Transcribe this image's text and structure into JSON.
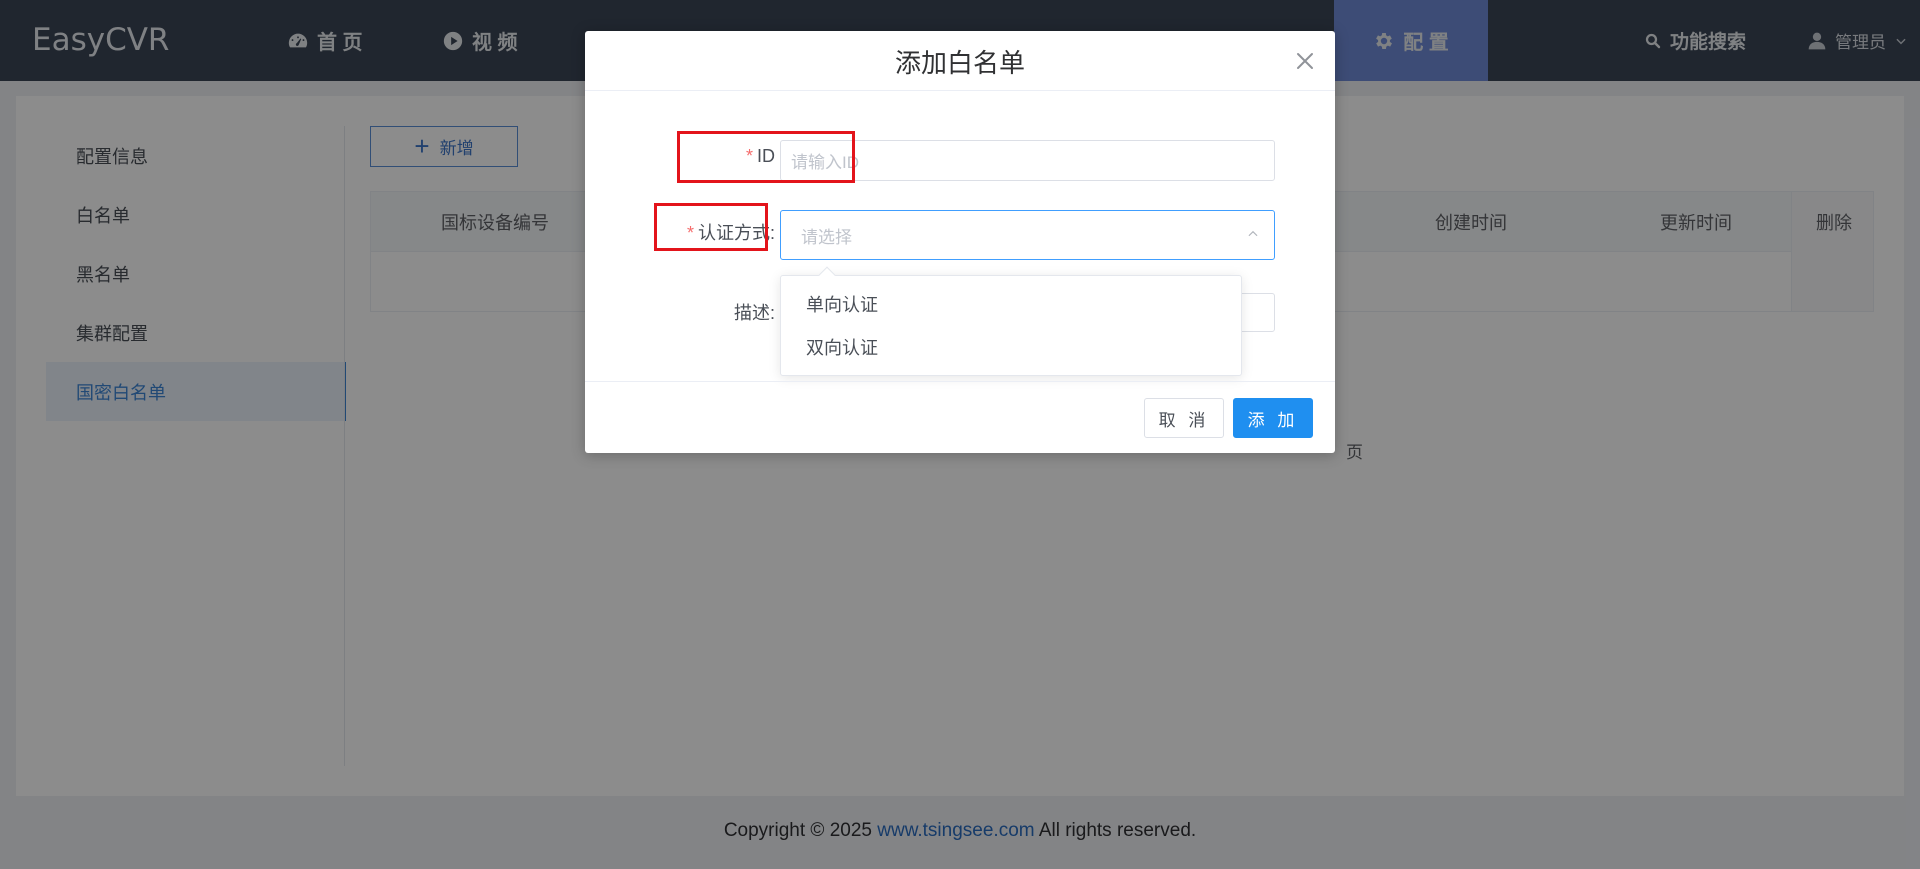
{
  "app": {
    "title": "EasyCVR"
  },
  "nav": {
    "home": "首 页",
    "video": "视 频",
    "config": "配 置",
    "search": "功能搜索",
    "user": "管理员"
  },
  "sidebar": {
    "items": [
      {
        "label": "配置信息"
      },
      {
        "label": "白名单"
      },
      {
        "label": "黑名单"
      },
      {
        "label": "集群配置"
      },
      {
        "label": "国密白名单"
      }
    ]
  },
  "toolbar": {
    "add_label": "新增"
  },
  "table": {
    "columns": [
      "国标设备编号",
      "创建时间",
      "更新时间",
      "删除"
    ]
  },
  "pager": {
    "tail": "页"
  },
  "dialog": {
    "title": "添加白名单",
    "fields": {
      "id": {
        "label": "ID",
        "placeholder": "请输入ID",
        "value": ""
      },
      "auth": {
        "label": "认证方式:",
        "placeholder": "请选择",
        "options": [
          "单向认证",
          "双向认证"
        ]
      },
      "desc": {
        "label": "描述:",
        "value": ""
      }
    },
    "cancel_label": "取 消",
    "confirm_label": "添 加"
  },
  "footer": {
    "prefix": "Copyright © 2025 ",
    "link": "www.tsingsee.com",
    "suffix": " All rights reserved."
  },
  "colors": {
    "topbar": "#3b4656",
    "nav_active": "#6f8bd8",
    "primary": "#1f8ff0",
    "highlight_box": "#e3141b"
  },
  "icons": {
    "home": "dashboard-icon",
    "video": "play-circle-icon",
    "config": "gear-icon",
    "search": "search-icon",
    "user": "user-icon",
    "close": "close-icon",
    "select": "chevron-up-icon"
  }
}
